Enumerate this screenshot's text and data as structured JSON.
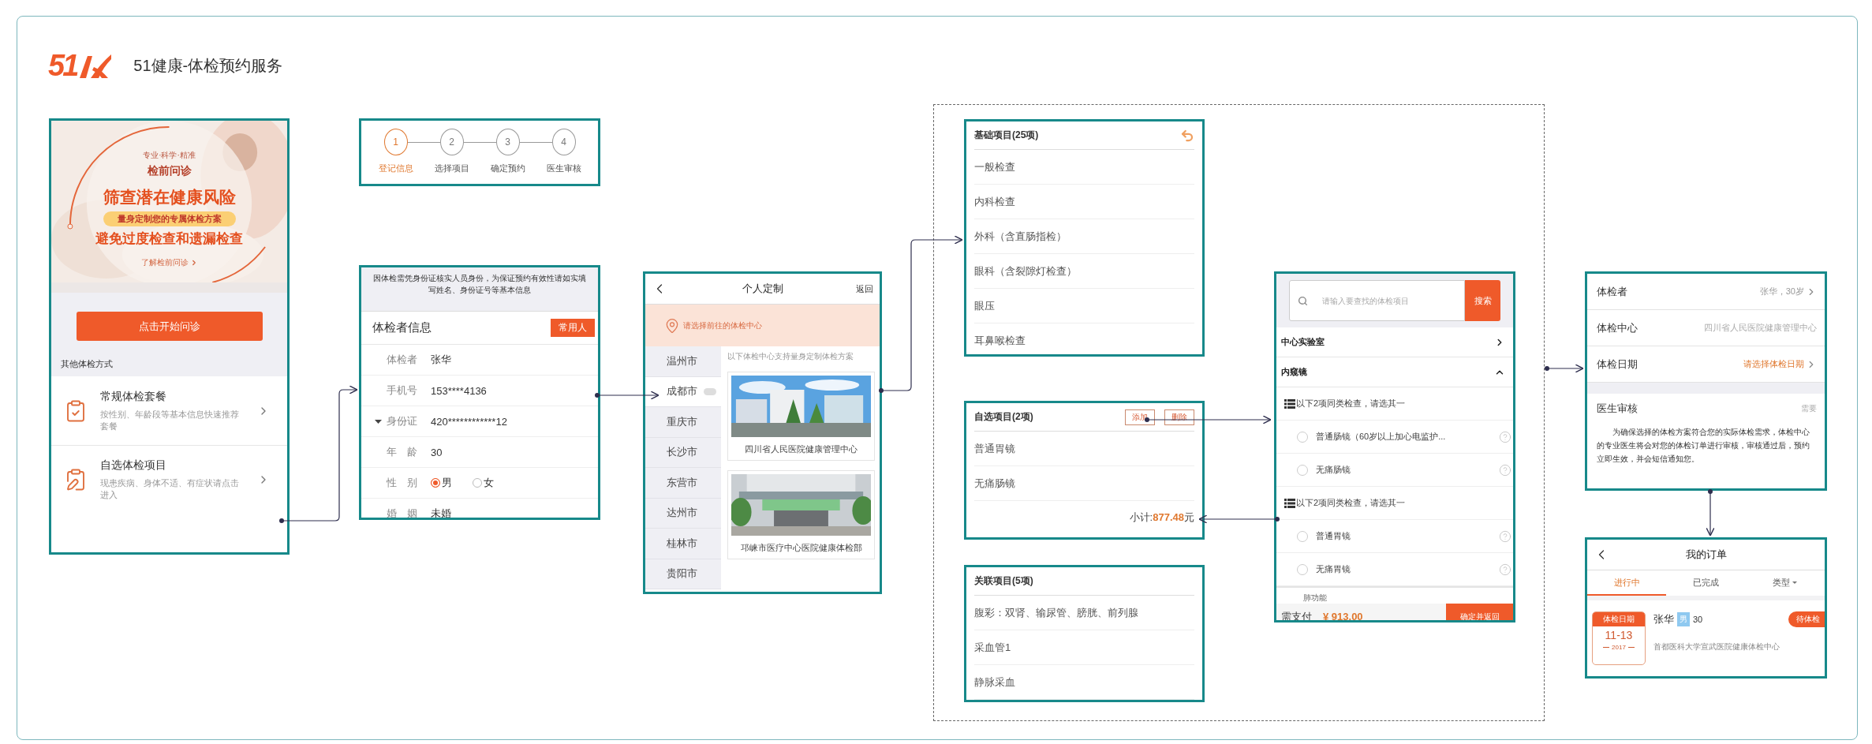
{
  "header": {
    "logo": "51",
    "title": "51健康-体检预约服务"
  },
  "intro": {
    "hero": {
      "tagline": "专业·科学·精准",
      "heading": "检前问诊",
      "headline": "筛查潜在健康风险",
      "pill": "量身定制您的专属体检方案",
      "subline": "避免过度检查和遗漏检查",
      "link": "了解检前问诊"
    },
    "start_button": "点击开始问诊",
    "other_label": "其他体检方式",
    "options": [
      {
        "title": "常规体检套餐",
        "description": "按性别、年龄段等基本信息快速推荐套餐"
      },
      {
        "title": "自选体检项目",
        "description": "现患疾病、身体不适、有症状请点击进入"
      }
    ]
  },
  "steps": [
    {
      "number": "1",
      "label": "登记信息",
      "selected": true
    },
    {
      "number": "2",
      "label": "选择项目",
      "selected": false
    },
    {
      "number": "3",
      "label": "确定预约",
      "selected": false
    },
    {
      "number": "4",
      "label": "医生审核",
      "selected": false
    }
  ],
  "registrant": {
    "notice": "因体检需凭身份证核实人员身份，为保证预约有效性请如实填写姓名、身份证号等基本信息",
    "title": "体检者信息",
    "contacts_button": "常用人",
    "fields": [
      {
        "kind": "text",
        "label": "体检者",
        "value": "张华"
      },
      {
        "kind": "text",
        "label": "手机号",
        "value": "153****4136"
      },
      {
        "kind": "select",
        "label": "身份证",
        "value": "420************12"
      },
      {
        "kind": "text",
        "label": "年　龄",
        "value": "30"
      },
      {
        "kind": "radio",
        "label": "性　别",
        "options": [
          {
            "label": "男",
            "selected": true
          },
          {
            "label": "女",
            "selected": false
          }
        ]
      },
      {
        "kind": "text",
        "label": "婚　姻",
        "value": "未婚"
      }
    ]
  },
  "customize": {
    "title": "个人定制",
    "return_label": "返回",
    "location_hint": "请选择前往的体检中心",
    "cities": [
      {
        "name": "温州市",
        "selected": false
      },
      {
        "name": "成都市",
        "selected": true
      },
      {
        "name": "重庆市",
        "selected": false
      },
      {
        "name": "长沙市",
        "selected": false
      },
      {
        "name": "东营市",
        "selected": false
      },
      {
        "name": "达州市",
        "selected": false
      },
      {
        "name": "桂林市",
        "selected": false
      },
      {
        "name": "贵阳市",
        "selected": false
      }
    ],
    "centers_hint": "以下体检中心支持量身定制体检方案",
    "centers": [
      {
        "name": "四川省人民医院健康管理中心",
        "kind": "picture"
      },
      {
        "name": "邛崃市医疗中心医院健康体检部",
        "kind": "picture"
      }
    ]
  },
  "basic_items": {
    "title": "基础项目(25项)",
    "items": [
      "一般检查",
      "内科检查",
      "外科（含直肠指检）",
      "眼科（含裂隙灯检查）",
      "眼压",
      "耳鼻喉检查"
    ]
  },
  "optional_items": {
    "title": "自选项目(2项)",
    "add_button": "添加",
    "delete_button": "删除",
    "items": [
      "普通胃镜",
      "无痛肠镜"
    ],
    "subtotal_label": "小计:",
    "subtotal_amount": "877.48",
    "subtotal_unit": "元"
  },
  "related_items": {
    "title": "关联项目(5项)",
    "items": [
      "腹彩：双肾、输尿管、膀胱、前列腺",
      "采血管1",
      "静脉采血"
    ]
  },
  "item_search": {
    "placeholder": "请输入要查找的体检项目",
    "search_button": "搜索",
    "categories": [
      {
        "name": "中心实验室",
        "expanded": false
      },
      {
        "name": "内窥镜",
        "expanded": true
      }
    ],
    "groups": [
      {
        "heading": "以下2项同类检查，请选其一",
        "options": [
          {
            "label": "普通肠镜（60岁以上加心电监护...",
            "selected": false
          },
          {
            "label": "无痛肠镜",
            "selected": false
          }
        ]
      },
      {
        "heading": "以下2项同类检查，请选其一",
        "options": [
          {
            "label": "普通胃镜",
            "selected": false
          },
          {
            "label": "无痛胃镜",
            "selected": false
          }
        ]
      }
    ],
    "partial_item": "肺功能",
    "total_label": "需支付",
    "total_amount": "¥ 913.00",
    "confirm_button": "确定并返回"
  },
  "confirm": {
    "rows": [
      {
        "label": "体检者",
        "value": "张华，30岁",
        "kind": "link"
      },
      {
        "label": "体检中心",
        "value": "四川省人民医院健康管理中心",
        "kind": "plain"
      },
      {
        "label": "体检日期",
        "value": "请选择体检日期",
        "kind": "prompt"
      }
    ],
    "review_label": "医生审核",
    "review_value": "需要",
    "review_note": "为确保选择的体检方案符合您的实际体检需求，体检中心的专业医生将会对您的体检订单进行审核，审核通过后，预约立即生效，并会短信通知您。"
  },
  "orders": {
    "title": "我的订单",
    "tabs": [
      {
        "label": "进行中",
        "selected": true,
        "kind": "plain"
      },
      {
        "label": "已完成",
        "selected": false,
        "kind": "plain"
      },
      {
        "label": "类型",
        "selected": false,
        "kind": "dropdown"
      }
    ],
    "order": {
      "date_label": "体检日期",
      "date": "11-13",
      "year": "2017",
      "name": "张华",
      "gender": "男",
      "age": "30",
      "status": "待体检",
      "center": "首都医科大学宣武医院健康体检中心"
    }
  }
}
